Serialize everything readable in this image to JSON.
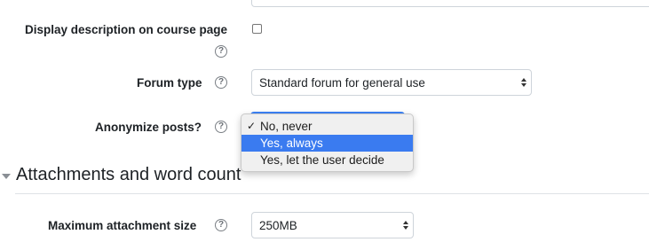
{
  "form": {
    "display_description_label": "Display description on course page",
    "forum_type": {
      "label": "Forum type",
      "value": "Standard forum for general use"
    },
    "anonymize": {
      "label": "Anonymize posts?",
      "options": [
        "No, never",
        "Yes, always",
        "Yes, let the user decide"
      ],
      "checked": "No, never",
      "highlighted": "Yes, always"
    },
    "section": {
      "title": "Attachments and word count"
    },
    "max_attachment": {
      "label": "Maximum attachment size",
      "value": "250MB"
    },
    "help_glyph": "?",
    "check_glyph": "✓"
  },
  "colors": {
    "highlight": "#3a7bf0",
    "text": "#1d2125",
    "border": "#ced4da"
  }
}
